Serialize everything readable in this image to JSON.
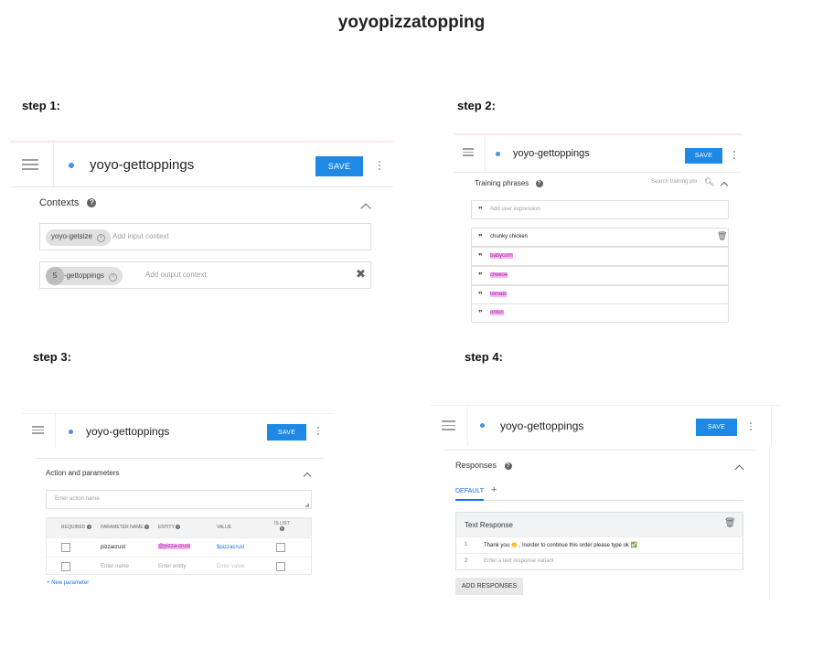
{
  "page_title": "yoyopizzatopping",
  "steps": {
    "s1": "step 1:",
    "s2": "step 2:",
    "s3": "step 3:",
    "s4": "step 4:"
  },
  "header": {
    "save_label": "SAVE"
  },
  "step1": {
    "intent_name": "yoyo-gettoppings",
    "section_title": "Contexts",
    "input_context_chip": "yoyo-getsize",
    "input_placeholder": "Add input context",
    "output_lifespan": "5",
    "output_context_chip": "yoyo-gettoppings",
    "output_placeholder": "Add output context"
  },
  "step2": {
    "intent_name": "yoyo-gettoppings",
    "section_title": "Training phrases",
    "search_placeholder": "Search training phr",
    "expression_placeholder": "Add user expression",
    "phrases": [
      {
        "text": "chunky chicken",
        "highlight": false
      },
      {
        "text": "babycorn",
        "highlight": true
      },
      {
        "text": "cheese",
        "highlight": true
      },
      {
        "text": "tomato",
        "highlight": true
      },
      {
        "text": "onion",
        "highlight": true
      }
    ]
  },
  "step3": {
    "intent_name": "yoyo-gettoppings",
    "section_title": "Action and parameters",
    "action_placeholder": "Enter action name",
    "columns": [
      "REQUIRED",
      "PARAMETER NAME",
      "ENTITY",
      "VALUE",
      "IS LIST"
    ],
    "rows": [
      {
        "name": "pizzacrust",
        "entity": "@pizza-crust",
        "value": "$pizzacrust"
      },
      {
        "name": "Enter name",
        "entity": "Enter entity",
        "value": "Enter value"
      }
    ],
    "new_parameter": "+ New parameter"
  },
  "step4": {
    "intent_name": "yoyo-gettoppings",
    "section_title": "Responses",
    "tab_default": "DEFAULT",
    "tab_add": "+",
    "card_title": "Text Response",
    "responses": [
      {
        "num": "1",
        "text": "Thank you 👏 , inorder to continue this order please type ok ✅"
      },
      {
        "num": "2",
        "text": "Enter a text response variant"
      }
    ],
    "add_responses": "ADD RESPONSES"
  }
}
